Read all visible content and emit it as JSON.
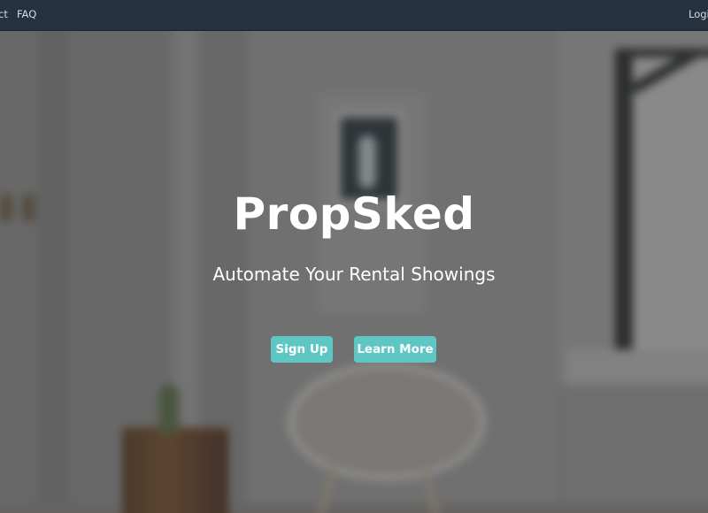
{
  "nav": {
    "contact_label": "ct",
    "faq_label": "FAQ",
    "login_label": "Logi"
  },
  "hero": {
    "title": "PropSked",
    "subtitle": "Automate Your Rental Showings",
    "signup_label": "Sign Up",
    "learn_more_label": "Learn More"
  },
  "colors": {
    "navbar_bg": "#26313f",
    "accent_button": "#5ec7c4",
    "hero_text": "#ffffff"
  }
}
